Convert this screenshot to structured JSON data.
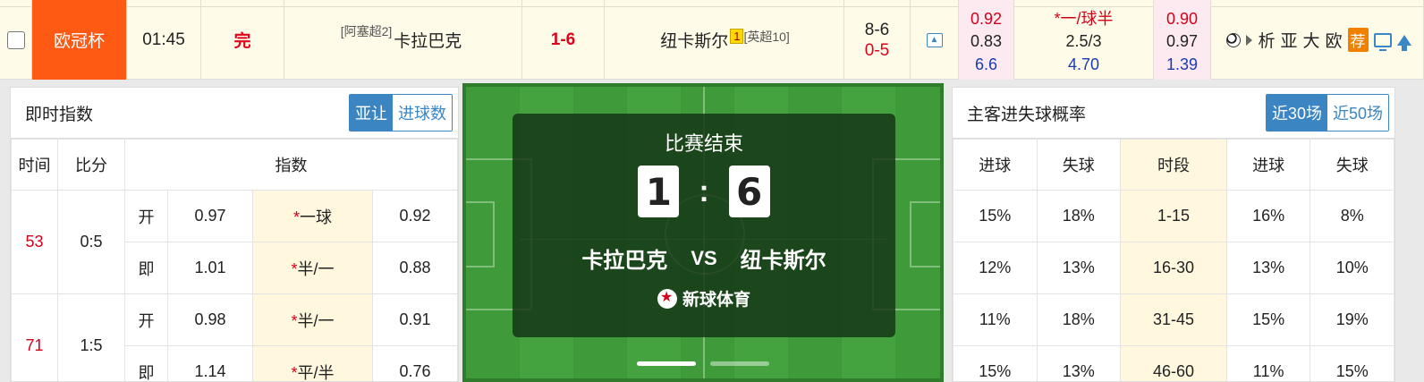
{
  "match": {
    "league": "欧冠杯",
    "time": "01:45",
    "status": "完",
    "home_rank": "[阿塞超2]",
    "home_team": "卡拉巴克",
    "score": "1-6",
    "away_team": "纽卡斯尔",
    "away_redcard": "1",
    "away_rank": "[英超10]",
    "half_top": "8-6",
    "half_bottom": "0-5",
    "odds_col1": [
      "0.92",
      "0.83",
      "6.6"
    ],
    "odds_col2": [
      "*一/球半",
      "2.5/3",
      "4.70"
    ],
    "odds_col3": [
      "0.90",
      "0.97",
      "1.39"
    ],
    "links": [
      "析",
      "亚",
      "大",
      "欧"
    ],
    "recommend": "荐",
    "icons": [
      "ball-icon",
      "play-arrow-icon",
      "tv-icon",
      "up-arrow-icon"
    ],
    "colors": {
      "league_bg": "#ff5a14",
      "score": "#e0001a",
      "recommend_bg": "#f08000"
    }
  },
  "live_index": {
    "title": "即时指数",
    "tabs": [
      "亚让",
      "进球数"
    ],
    "active_tab": "亚让",
    "headers": [
      "时间",
      "比分",
      "指数"
    ],
    "rows": [
      {
        "time": "53",
        "score": "0:5",
        "lines": [
          {
            "label": "开",
            "home": "0.97",
            "star": "*",
            "handicap": "一球",
            "away": "0.92"
          },
          {
            "label": "即",
            "home": "1.01",
            "star": "*",
            "handicap": "半/一",
            "away": "0.88"
          }
        ]
      },
      {
        "time": "71",
        "score": "1:5",
        "lines": [
          {
            "label": "开",
            "home": "0.98",
            "star": "*",
            "handicap": "半/一",
            "away": "0.91"
          },
          {
            "label": "即",
            "home": "1.14",
            "star": "*",
            "handicap": "平/半",
            "away": "0.76"
          }
        ]
      }
    ]
  },
  "scoreboard": {
    "status": "比赛结束",
    "home_score": "1",
    "colon": ":",
    "away_score": "6",
    "home_team": "卡拉巴克",
    "vs": "VS",
    "away_team": "纽卡斯尔",
    "brand": "新球体育"
  },
  "goal_prob": {
    "title": "主客进失球概率",
    "tabs": [
      "近30场",
      "近50场"
    ],
    "active_tab": "近30场",
    "headers": [
      "进球",
      "失球",
      "时段",
      "进球",
      "失球"
    ],
    "rows": [
      [
        "15%",
        "18%",
        "1-15",
        "16%",
        "8%"
      ],
      [
        "12%",
        "13%",
        "16-30",
        "13%",
        "10%"
      ],
      [
        "11%",
        "18%",
        "31-45",
        "15%",
        "19%"
      ],
      [
        "15%",
        "13%",
        "46-60",
        "11%",
        "15%"
      ]
    ]
  }
}
